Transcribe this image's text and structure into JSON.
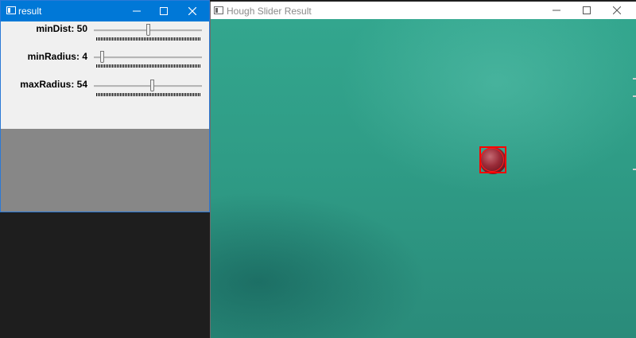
{
  "result_window": {
    "title": "result",
    "trackbars": [
      {
        "label": "minDist: 50",
        "value": 50,
        "fill": 0.5
      },
      {
        "label": "minRadius: 4",
        "value": 4,
        "fill": 0.04
      },
      {
        "label": "maxRadius: 54",
        "value": 54,
        "fill": 0.54
      }
    ]
  },
  "hough_window": {
    "title": "Hough Slider Result"
  },
  "colors": {
    "accent_titlebar": "#0078d7",
    "detection": "#ff0000",
    "felt": "#2f9c86"
  },
  "icons": [
    "app-icon",
    "minimize-icon",
    "maximize-icon",
    "close-icon"
  ]
}
